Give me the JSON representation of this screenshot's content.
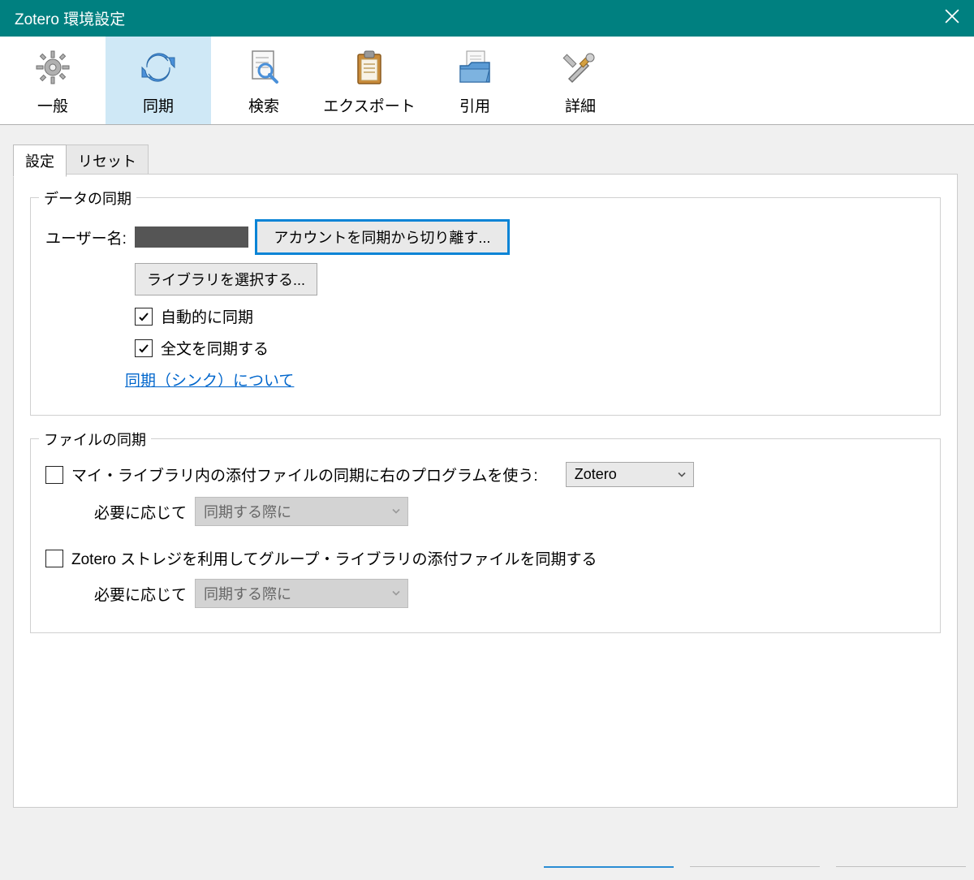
{
  "window": {
    "title": "Zotero 環境設定"
  },
  "toolbar": {
    "general": {
      "label": "一般"
    },
    "sync": {
      "label": "同期"
    },
    "search": {
      "label": "検索"
    },
    "export": {
      "label": "エクスポート"
    },
    "cite": {
      "label": "引用"
    },
    "advanced": {
      "label": "詳細"
    }
  },
  "subtabs": {
    "settings": "設定",
    "reset": "リセット"
  },
  "dataSync": {
    "legend": "データの同期",
    "usernameLabel": "ユーザー名:",
    "unlinkButton": "アカウントを同期から切り離す...",
    "chooseLibrariesButton": "ライブラリを選択する...",
    "autoSyncLabel": "自動的に同期",
    "fulltextSyncLabel": "全文を同期する",
    "aboutSyncLink": "同期（シンク）について"
  },
  "fileSync": {
    "legend": "ファイルの同期",
    "myLibLabel": "マイ・ライブラリ内の添付ファイルの同期に右のプログラムを使う:",
    "myLibProgram": "Zotero",
    "asNeededLabel": "必要に応じて",
    "whenSyncingOption": "同期する際に",
    "groupLibLabel": "Zotero ストレジを利用してグループ・ライブラリの添付ファイルを同期する"
  },
  "colors": {
    "titlebar": "#008080",
    "accent": "#0a84d6",
    "link": "#0066cc"
  }
}
